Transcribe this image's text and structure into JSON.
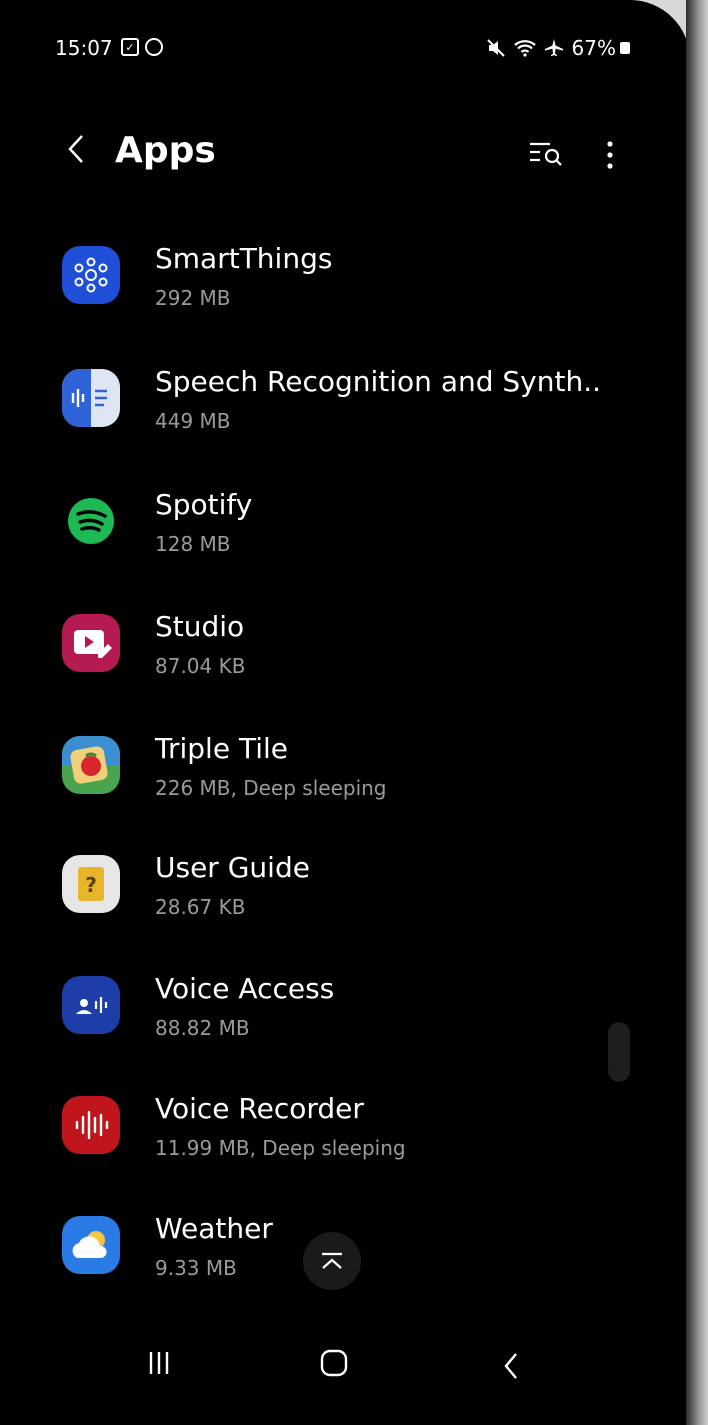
{
  "status_bar": {
    "time": "15:07",
    "battery": "67%"
  },
  "header": {
    "title": "Apps"
  },
  "apps": [
    {
      "name": "SmartThings",
      "size": "292 MB",
      "icon": "smartthings-icon"
    },
    {
      "name": "Speech Recognition and Synth..",
      "size": "449 MB",
      "icon": "speech-recognition-icon"
    },
    {
      "name": "Spotify",
      "size": "128 MB",
      "icon": "spotify-icon"
    },
    {
      "name": "Studio",
      "size": "87.04 KB",
      "icon": "studio-icon"
    },
    {
      "name": "Triple Tile",
      "size": "226 MB, Deep sleeping",
      "icon": "triple-tile-icon"
    },
    {
      "name": "User Guide",
      "size": "28.67 KB",
      "icon": "user-guide-icon"
    },
    {
      "name": "Voice Access",
      "size": "88.82 MB",
      "icon": "voice-access-icon"
    },
    {
      "name": "Voice Recorder",
      "size": "11.99 MB, Deep sleeping",
      "icon": "voice-recorder-icon"
    },
    {
      "name": "Weather",
      "size": "9.33 MB",
      "icon": "weather-icon"
    }
  ],
  "colors": {
    "background": "#000000",
    "text": "#ffffff",
    "secondary_text": "#9a9a9a"
  }
}
